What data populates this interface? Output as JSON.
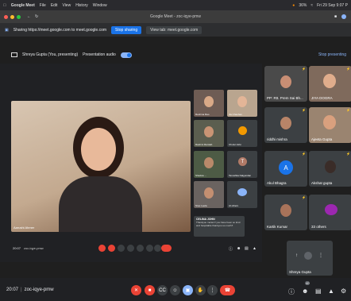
{
  "menubar": {
    "app": "Google Meet",
    "items": [
      "File",
      "Edit",
      "View",
      "History",
      "Window"
    ],
    "battery": "36%",
    "datetime": "Fri 29 Sep 9:07 P"
  },
  "browser": {
    "tab_title": "Google Meet - zoc-iqye-pmw",
    "share_notice": "Sharing https://meet.google.com to meet.google.com",
    "stop_sharing": "Stop sharing",
    "view_tab": "View tab: meet.google.com"
  },
  "presenting": {
    "label": "Shreya Gupta (You, presenting)",
    "audio_label": "Presentation audio",
    "stop_label": "Stop presenting"
  },
  "inner": {
    "main_name": "Aarushi Ahmer",
    "time": "20:07",
    "meeting_code": "zoc-iqye-pmw",
    "tiles": [
      "Reshma Rao",
      "Jia Chauhan",
      "Rashmi Ramiah",
      "Ch.del John",
      "Shadow ...",
      "Tanushka Nalgundan",
      "Sree Leela",
      "AI others"
    ],
    "chat_name": "CELINA JOHN",
    "chat_text": "Thankyou ma'am!! you have been so kind and hospitable thankyou so much!!"
  },
  "participants": [
    {
      "name": "PP: Rtt. Prem Sai Bh...",
      "type": "video"
    },
    {
      "name": "JIYA DOGRA",
      "type": "video"
    },
    {
      "name": "riddhi mishra",
      "type": "video"
    },
    {
      "name": "Ajeeta Gupta",
      "type": "video"
    },
    {
      "name": "Akul Bhagra",
      "type": "avatar",
      "initial": "A"
    },
    {
      "name": "Akshat gupta",
      "type": "video"
    },
    {
      "name": "Kartik Kumar",
      "type": "video"
    },
    {
      "name": "33 others",
      "type": "others"
    }
  ],
  "self_tile": {
    "name": "Shreya Gupta"
  },
  "bottom": {
    "time": "20:07",
    "separator": "|",
    "meeting_code": "zoc-iqye-pmw",
    "participant_count": "40"
  },
  "colors": {
    "accent": "#1a73e8",
    "danger": "#ea4335",
    "surface": "#3c4043"
  }
}
